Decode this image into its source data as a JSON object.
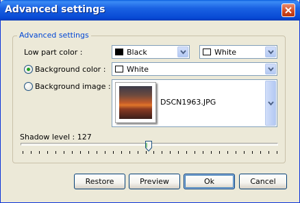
{
  "window": {
    "title": "Advanced settings"
  },
  "group": {
    "legend": "Advanced settings"
  },
  "low_part_color": {
    "label": "Low part color :",
    "left": {
      "value": "Black",
      "color": "#000000"
    },
    "right": {
      "value": "White",
      "color": "#FFFFFF"
    }
  },
  "background_color": {
    "label": "Background color :",
    "value": "White",
    "color": "#FFFFFF",
    "checked": true
  },
  "background_image": {
    "label": "Background image :",
    "filename": "DSCN1963.JPG",
    "checked": false
  },
  "shadow": {
    "label": "Shadow level : 127",
    "level": 127,
    "max": 255
  },
  "buttons": {
    "restore": "Restore",
    "preview": "Preview",
    "ok": "Ok",
    "cancel": "Cancel"
  },
  "colors": {
    "titlebar": "#0A5FDE",
    "accent": "#0046D5",
    "face": "#ECE9D8"
  }
}
